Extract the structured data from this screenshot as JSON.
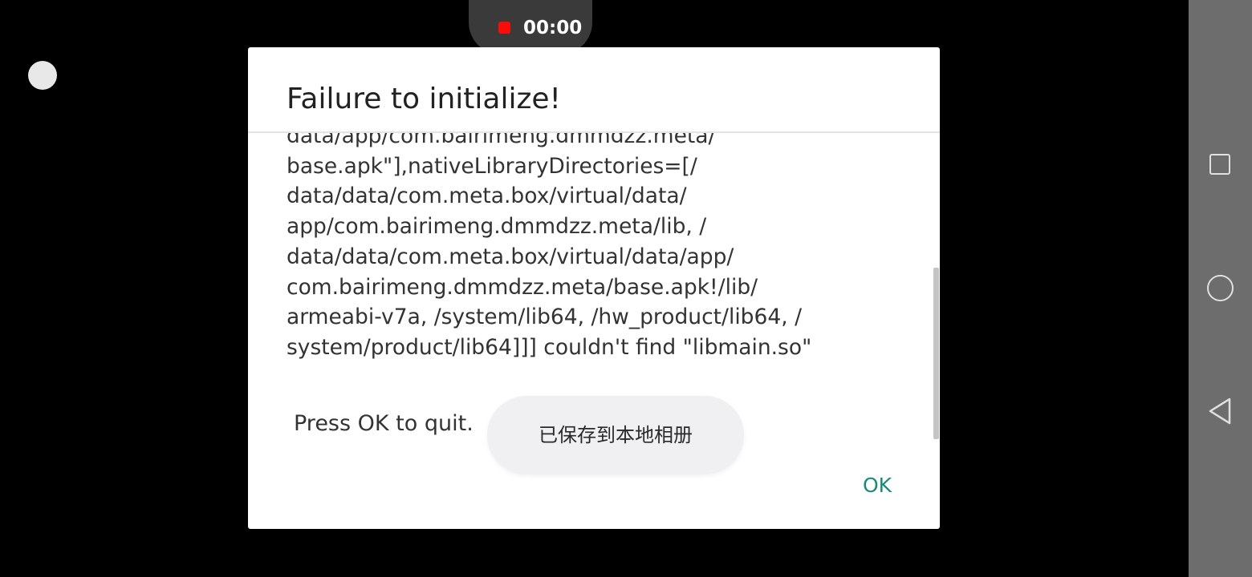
{
  "recording": {
    "time": "00:00",
    "indicator_color": "#ff0a0a"
  },
  "dialog": {
    "title": "Failure to initialize!",
    "message_lines": [
      "data/app/com.bairimeng.dmmdzz.meta/",
      "base.apk\"],nativeLibraryDirectories=[/",
      "data/data/com.meta.box/virtual/data/",
      "app/com.bairimeng.dmmdzz.meta/lib, /",
      "data/data/com.meta.box/virtual/data/app/",
      "com.bairimeng.dmmdzz.meta/base.apk!/lib/",
      "armeabi-v7a, /system/lib64, /hw_product/lib64, /",
      "system/product/lib64]]] couldn't find \"libmain.so\""
    ],
    "quit_text": "Press OK to quit.",
    "ok_label": "OK",
    "accent_color": "#1a8a7c"
  },
  "toast": {
    "text": "已保存到本地相册"
  },
  "nav_bar": {
    "icons": [
      "recent-apps-icon",
      "home-icon",
      "back-icon"
    ]
  }
}
